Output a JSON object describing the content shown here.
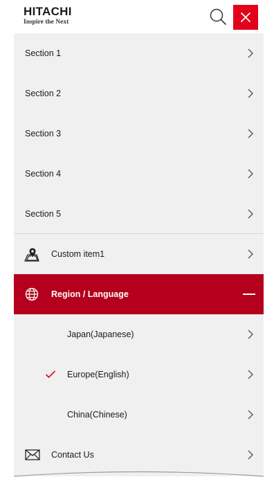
{
  "header": {
    "logo_main": "HITACHI",
    "logo_tagline": "Inspire the Next",
    "search_icon": "search-icon",
    "close_icon": "close-icon",
    "accent_color": "#e3001b"
  },
  "menu": {
    "sections": [
      {
        "label": "Section 1"
      },
      {
        "label": "Section 2"
      },
      {
        "label": "Section 3"
      },
      {
        "label": "Section 4"
      },
      {
        "label": "Section 5"
      }
    ],
    "custom_item": {
      "label": "Custom item1",
      "icon": "map-pin-icon"
    },
    "region": {
      "label": "Region / Language",
      "icon": "globe-icon",
      "expanded": true,
      "bg_color": "#b4001c",
      "options": [
        {
          "label": "Japan(Japanese)",
          "selected": false
        },
        {
          "label": "Europe(English)",
          "selected": true
        },
        {
          "label": "China(Chinese)",
          "selected": false
        }
      ]
    },
    "contact": {
      "label": "Contact Us",
      "icon": "envelope-icon"
    }
  }
}
